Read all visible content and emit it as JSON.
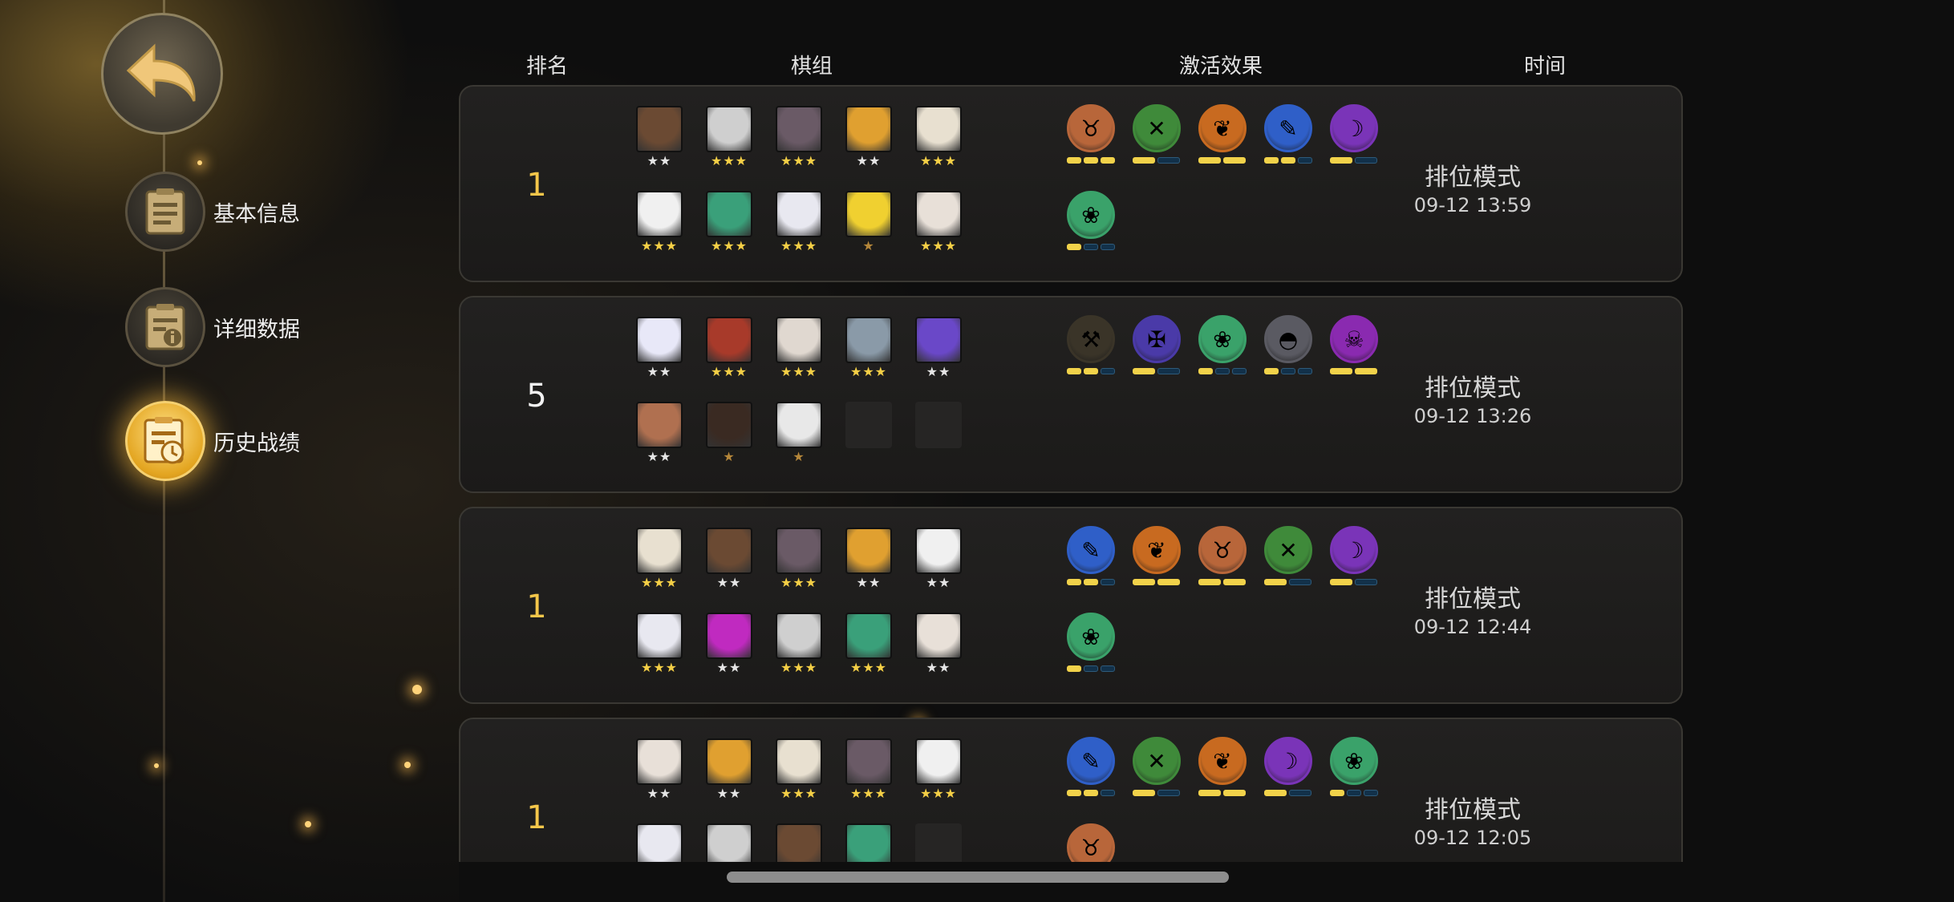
{
  "nav": {
    "items": [
      {
        "label": "基本信息",
        "icon": "document-icon",
        "active": false
      },
      {
        "label": "详细数据",
        "icon": "info-document-icon",
        "active": false
      },
      {
        "label": "历史战绩",
        "icon": "history-clock-icon",
        "active": true
      }
    ]
  },
  "headers": {
    "rank": "排名",
    "lineup": "棋组",
    "traits": "激活效果",
    "time": "时间"
  },
  "matches": [
    {
      "rank": "1",
      "units": [
        {
          "stars": "★★",
          "tier": 2,
          "color": "#6b4a33"
        },
        {
          "stars": "★★★",
          "tier": 3,
          "color": "#cfcfcf"
        },
        {
          "stars": "★★★",
          "tier": 3,
          "color": "#6a5a66"
        },
        {
          "stars": "★★",
          "tier": 2,
          "color": "#e0a030"
        },
        {
          "stars": "★★★",
          "tier": 3,
          "color": "#e8e0d0"
        },
        {
          "stars": "★★★",
          "tier": 3,
          "color": "#f0f0f0"
        },
        {
          "stars": "★★★",
          "tier": 3,
          "color": "#3aa07a"
        },
        {
          "stars": "★★★",
          "tier": 3,
          "color": "#e8e8f0"
        },
        {
          "stars": "★",
          "tier": 1,
          "color": "#f0d030"
        },
        {
          "stars": "★★★",
          "tier": 3,
          "color": "#e8e0d8"
        }
      ],
      "traits": [
        {
          "icon": "demon-icon",
          "color": "#b8663a",
          "bars": [
            1,
            1,
            1
          ]
        },
        {
          "icon": "crossbow-icon",
          "color": "#3f8a3a",
          "bars": [
            1,
            0
          ]
        },
        {
          "icon": "leaf-icon",
          "color": "#c86a20",
          "bars": [
            1,
            1
          ]
        },
        {
          "icon": "feather-icon",
          "color": "#2f5fc8",
          "bars": [
            1,
            1,
            0
          ]
        },
        {
          "icon": "warlock-icon",
          "color": "#7a34b8",
          "bars": [
            1,
            0
          ]
        },
        {
          "icon": "paw-icon",
          "color": "#3aa26a",
          "bars": [
            1,
            0,
            0
          ]
        }
      ],
      "mode": "排位模式",
      "time": "09-12 13:59"
    },
    {
      "rank": "5",
      "units": [
        {
          "stars": "★★",
          "tier": 2,
          "color": "#e8e8f8"
        },
        {
          "stars": "★★★",
          "tier": 3,
          "color": "#a83a2a"
        },
        {
          "stars": "★★★",
          "tier": 3,
          "color": "#e0d8d0"
        },
        {
          "stars": "★★★",
          "tier": 3,
          "color": "#8a9aa8"
        },
        {
          "stars": "★★",
          "tier": 2,
          "color": "#6a48c8"
        },
        {
          "stars": "★★",
          "tier": 2,
          "color": "#b07050"
        },
        {
          "stars": "★",
          "tier": 1,
          "color": "#3a2a22"
        },
        {
          "stars": "★",
          "tier": 1,
          "color": "#e8e8e8"
        },
        {
          "stars": "",
          "tier": 0,
          "color": ""
        },
        {
          "stars": "",
          "tier": 0,
          "color": ""
        }
      ],
      "traits": [
        {
          "icon": "axe-icon",
          "color": "#3a3428",
          "bars": [
            1,
            1,
            0
          ]
        },
        {
          "icon": "fish-bone-icon",
          "color": "#4a3aa8",
          "bars": [
            1,
            0
          ]
        },
        {
          "icon": "paw-icon",
          "color": "#3aa26a",
          "bars": [
            1,
            0,
            0
          ]
        },
        {
          "icon": "helmet-icon",
          "color": "#5a5a62",
          "bars": [
            1,
            0,
            0
          ]
        },
        {
          "icon": "skull-icon",
          "color": "#8a2ab0",
          "bars": [
            1,
            1
          ]
        }
      ],
      "mode": "排位模式",
      "time": "09-12 13:26"
    },
    {
      "rank": "1",
      "units": [
        {
          "stars": "★★★",
          "tier": 3,
          "color": "#e8e0d0"
        },
        {
          "stars": "★★",
          "tier": 2,
          "color": "#6b4a33"
        },
        {
          "stars": "★★★",
          "tier": 3,
          "color": "#6a5a66"
        },
        {
          "stars": "★★",
          "tier": 2,
          "color": "#e0a030"
        },
        {
          "stars": "★★",
          "tier": 2,
          "color": "#f0f0f0"
        },
        {
          "stars": "★★★",
          "tier": 3,
          "color": "#e8e8f0"
        },
        {
          "stars": "★★",
          "tier": 2,
          "color": "#c02ac0"
        },
        {
          "stars": "★★★",
          "tier": 3,
          "color": "#cfcfcf"
        },
        {
          "stars": "★★★",
          "tier": 3,
          "color": "#3aa07a"
        },
        {
          "stars": "★★",
          "tier": 2,
          "color": "#e8e0d8"
        }
      ],
      "traits": [
        {
          "icon": "feather-icon",
          "color": "#2f5fc8",
          "bars": [
            1,
            1,
            0
          ]
        },
        {
          "icon": "leaf-icon",
          "color": "#c86a20",
          "bars": [
            1,
            1
          ]
        },
        {
          "icon": "demon-icon",
          "color": "#b8663a",
          "bars": [
            1,
            1
          ]
        },
        {
          "icon": "crossbow-icon",
          "color": "#3f8a3a",
          "bars": [
            1,
            0
          ]
        },
        {
          "icon": "warlock-icon",
          "color": "#7a34b8",
          "bars": [
            1,
            0
          ]
        },
        {
          "icon": "paw-icon",
          "color": "#3aa26a",
          "bars": [
            1,
            0,
            0
          ]
        }
      ],
      "mode": "排位模式",
      "time": "09-12 12:44"
    },
    {
      "rank": "1",
      "units": [
        {
          "stars": "★★",
          "tier": 2,
          "color": "#e8e0d8"
        },
        {
          "stars": "★★",
          "tier": 2,
          "color": "#e0a030"
        },
        {
          "stars": "★★★",
          "tier": 3,
          "color": "#e8e0d0"
        },
        {
          "stars": "★★★",
          "tier": 3,
          "color": "#6a5a66"
        },
        {
          "stars": "★★★",
          "tier": 3,
          "color": "#f0f0f0"
        },
        {
          "stars": "",
          "tier": 0,
          "color": "#e8e8f0"
        },
        {
          "stars": "",
          "tier": 0,
          "color": "#cfcfcf"
        },
        {
          "stars": "",
          "tier": 0,
          "color": "#6b4a33"
        },
        {
          "stars": "",
          "tier": 0,
          "color": "#3aa07a"
        },
        {
          "stars": "",
          "tier": 0,
          "color": ""
        }
      ],
      "traits": [
        {
          "icon": "feather-icon",
          "color": "#2f5fc8",
          "bars": [
            1,
            1,
            0
          ]
        },
        {
          "icon": "crossbow-icon",
          "color": "#3f8a3a",
          "bars": [
            1,
            0
          ]
        },
        {
          "icon": "leaf-icon",
          "color": "#c86a20",
          "bars": [
            1,
            1
          ]
        },
        {
          "icon": "warlock-icon",
          "color": "#7a34b8",
          "bars": [
            1,
            0
          ]
        },
        {
          "icon": "paw-icon",
          "color": "#3aa26a",
          "bars": [
            1,
            0,
            0
          ]
        },
        {
          "icon": "demon-icon",
          "color": "#b8663a",
          "bars": []
        }
      ],
      "mode": "排位模式",
      "time": "09-12 12:05"
    }
  ]
}
